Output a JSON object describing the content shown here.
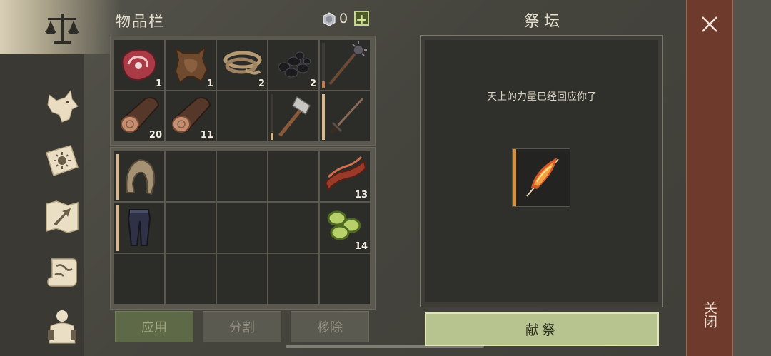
{
  "inventory": {
    "title": "物品栏",
    "currency": {
      "icon": "gem-icon",
      "count": "0",
      "add_label": "+"
    },
    "bag_slots": [
      {
        "item": "raw-meat-icon",
        "count": "1"
      },
      {
        "item": "animal-hide-icon",
        "count": "1"
      },
      {
        "item": "rope-icon",
        "count": "2"
      },
      {
        "item": "coal-icon",
        "count": "2"
      },
      {
        "item": "spiked-mace-icon",
        "count": ""
      },
      {
        "item": "log-icon",
        "count": "20"
      },
      {
        "item": "log-icon",
        "count": "11"
      },
      {
        "item": "",
        "count": ""
      },
      {
        "item": "stone-hammer-icon",
        "count": ""
      },
      {
        "item": "iron-sword-icon",
        "count": ""
      }
    ],
    "equip_slots": [
      {
        "item": "leather-hood-icon",
        "count": ""
      },
      {
        "item": "",
        "count": ""
      },
      {
        "item": "",
        "count": ""
      },
      {
        "item": "",
        "count": ""
      },
      {
        "item": "bacon-icon",
        "count": "13"
      },
      {
        "item": "leather-pants-icon",
        "count": ""
      },
      {
        "item": "",
        "count": ""
      },
      {
        "item": "",
        "count": ""
      },
      {
        "item": "",
        "count": ""
      },
      {
        "item": "cucumber-slices-icon",
        "count": "14"
      },
      {
        "item": "",
        "count": ""
      },
      {
        "item": "",
        "count": ""
      },
      {
        "item": "",
        "count": ""
      },
      {
        "item": "",
        "count": ""
      },
      {
        "item": "",
        "count": ""
      }
    ],
    "buttons": {
      "apply": "应用",
      "split": "分割",
      "remove": "移除"
    }
  },
  "altar": {
    "title": "祭坛",
    "message": "天上的力量已经回应你了",
    "slot_item": "flaming-feather-icon",
    "offer_label": "献祭"
  },
  "close": {
    "label": "关闭",
    "icon": "close-icon"
  },
  "sidebar": {
    "items": [
      {
        "icon": "scales-icon",
        "active": true
      },
      {
        "icon": "wolf-icon",
        "active": false
      },
      {
        "icon": "sun-book-icon",
        "active": false
      },
      {
        "icon": "map-arrow-icon",
        "active": false
      },
      {
        "icon": "scroll-icon",
        "active": false
      },
      {
        "icon": "character-icon",
        "active": false
      }
    ]
  },
  "colors": {
    "accent_green": "#b8c490",
    "close_red": "#6e3a2c",
    "durability": "#d7b98a"
  }
}
